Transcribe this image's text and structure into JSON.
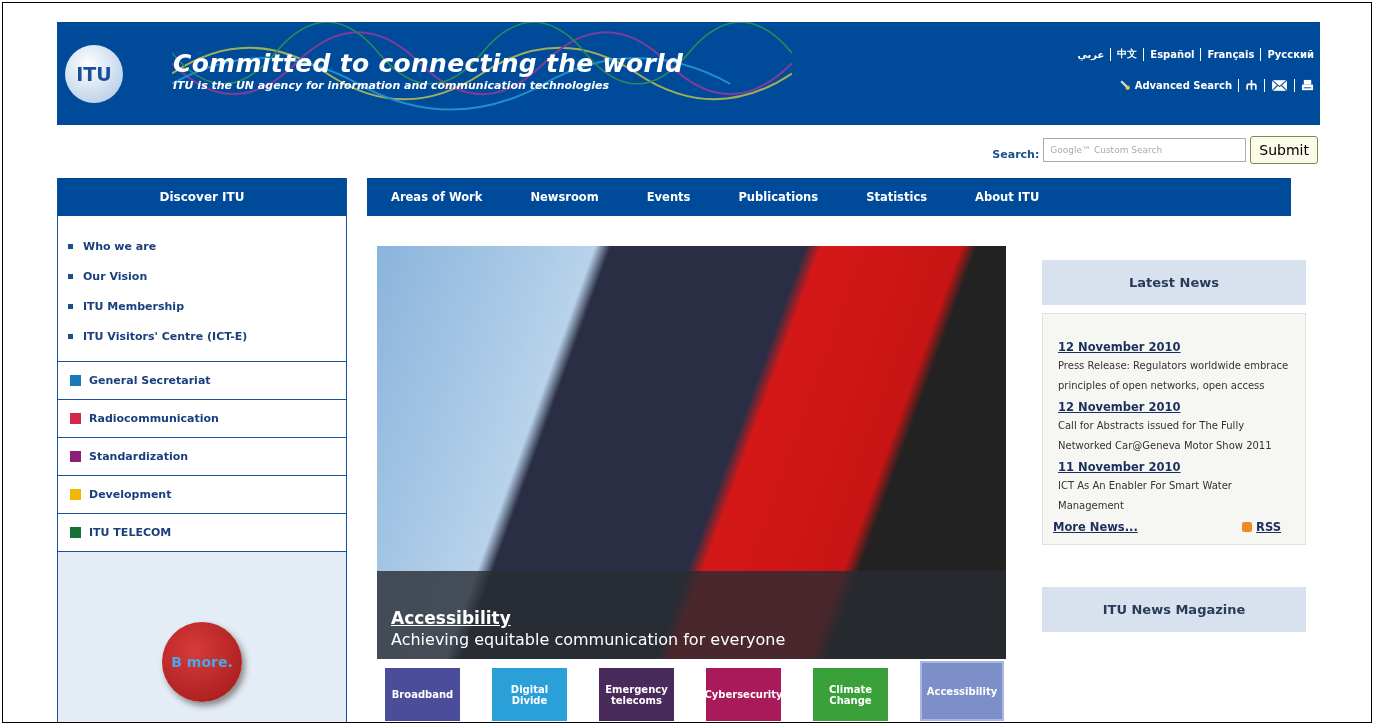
{
  "header": {
    "title": "Committed to connecting the world",
    "subtitle": "ITU is the UN agency for information and communication technologies",
    "logo_text": "ITU",
    "languages": [
      "عربي",
      "中文",
      "Español",
      "Français",
      "Русский"
    ],
    "tools": [
      {
        "kind": "search",
        "label": "Advanced Search"
      },
      {
        "kind": "sitemap"
      },
      {
        "kind": "mail"
      },
      {
        "kind": "print"
      }
    ]
  },
  "search": {
    "label": "Search:",
    "placeholder": "Google™ Custom Search",
    "button": "Submit"
  },
  "sidebar": {
    "title": "Discover ITU",
    "links": [
      "Who we are",
      "Our Vision",
      "ITU Membership",
      "ITU Visitors' Centre (ICT-E)"
    ],
    "sectors": [
      {
        "label": "General Secretariat",
        "color": "#1a7ab5"
      },
      {
        "label": "Radiocommunication",
        "color": "#d2264a"
      },
      {
        "label": "Standardization",
        "color": "#8a1f7c"
      },
      {
        "label": "Development",
        "color": "#f2b705"
      },
      {
        "label": "ITU TELECOM",
        "color": "#17703a"
      }
    ],
    "badge": "B more."
  },
  "nav": [
    "Areas of Work",
    "Newsroom",
    "Events",
    "Publications",
    "Statistics",
    "About ITU"
  ],
  "hero": {
    "title": "Accessibility",
    "caption": "Achieving equitable communication for everyone"
  },
  "themes": [
    {
      "label": "Broadband",
      "color": "#4b4d9a",
      "selected": false
    },
    {
      "label": "Digital Divide",
      "color": "#2a9fd8",
      "selected": false
    },
    {
      "label": "Emergency telecoms",
      "color": "#4a2a5a",
      "selected": false
    },
    {
      "label": "Cybersecurity",
      "color": "#a81a5a",
      "selected": false
    },
    {
      "label": "Climate Change",
      "color": "#3aa13a",
      "selected": false
    },
    {
      "label": "Accessibility",
      "color": "#7d8fc8",
      "selected": true
    }
  ],
  "news": {
    "title": "Latest News",
    "items": [
      {
        "date": "12 November 2010",
        "text": "Press Release: Regulators worldwide embrace principles of open networks, open access"
      },
      {
        "date": "12 November 2010",
        "text": "Call for Abstracts issued for The Fully Networked Car@Geneva Motor Show 2011"
      },
      {
        "date": "11 November 2010",
        "text": "ICT As An Enabler For Smart Water Management"
      }
    ],
    "more": "More News...",
    "rss": "RSS"
  },
  "magazine": {
    "title": "ITU News Magazine"
  }
}
